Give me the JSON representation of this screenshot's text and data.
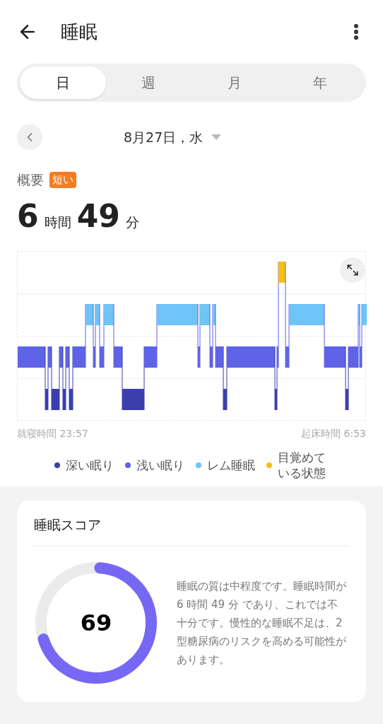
{
  "header": {
    "title": "睡眠"
  },
  "tabs": [
    {
      "label": "日",
      "selected": true
    },
    {
      "label": "週",
      "selected": false
    },
    {
      "label": "月",
      "selected": false
    },
    {
      "label": "年",
      "selected": false
    }
  ],
  "date": {
    "label": "8月27日，水"
  },
  "summary": {
    "title": "概要",
    "badge": "短い",
    "hours": "6",
    "hours_unit": "時間",
    "minutes": "49",
    "minutes_unit": "分"
  },
  "chart": {
    "start_label": "就寝時間 23:57",
    "end_label": "起床時間 6:53"
  },
  "legend": [
    {
      "label": "深い眠り",
      "color": "#3b3fae"
    },
    {
      "label": "浅い眠り",
      "color": "#5f63e6"
    },
    {
      "label": "レム睡眠",
      "color": "#6ec3f7"
    },
    {
      "label": "目覚めている状態",
      "color": "#f9bf10"
    }
  ],
  "score_card": {
    "title": "睡眠スコア",
    "score": "69",
    "description": "睡眠の質は中程度です。睡眠時間が 6 時間 49 分 であり、これでは不十分です。慢性的な睡眠不足は、2型糖尿病のリスクを高める可能性があります。"
  }
}
